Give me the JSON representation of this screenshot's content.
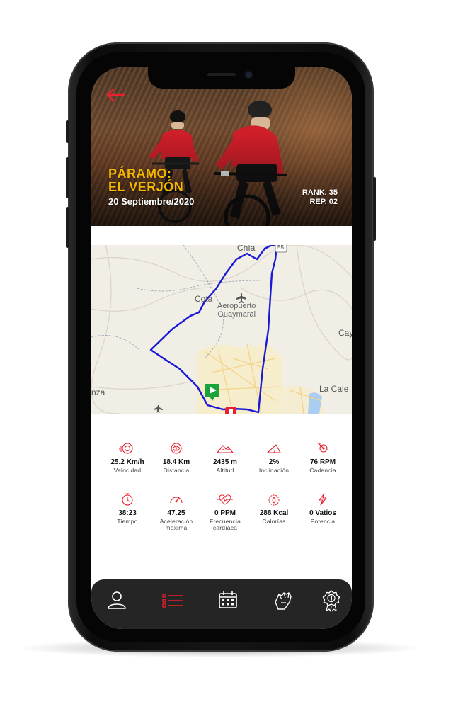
{
  "event": {
    "title": "PÁRAMO:\nEL VERJÓN",
    "date": "20 Septiembre/2020",
    "rank": "RANK. 35",
    "rep": "REP. 02"
  },
  "map": {
    "labels": {
      "chia": "Chía",
      "route_55": "55",
      "cota": "Cota",
      "airport": "Aeropuerto\nGuaymaral",
      "cay": "Cay",
      "la_cale": "La Cale",
      "nza": "nza"
    }
  },
  "stats": [
    {
      "value": "25.2 Km/h",
      "label": "Velocidad",
      "icon": "speedometer-icon"
    },
    {
      "value": "18.4 Km",
      "label": "Distancia",
      "icon": "distance-icon"
    },
    {
      "value": "2435 m",
      "label": "Altitud",
      "icon": "mountain-icon"
    },
    {
      "value": "2%",
      "label": "Inclinación",
      "icon": "incline-icon"
    },
    {
      "value": "76 RPM",
      "label": "Cadencia",
      "icon": "cadence-icon"
    },
    {
      "value": "38:23",
      "label": "Tiempo",
      "icon": "stopwatch-icon"
    },
    {
      "value": "47.25",
      "label": "Aceleración\nmáxima",
      "icon": "gauge-icon"
    },
    {
      "value": "0 PPM",
      "label": "Frecuencia\ncardíaca",
      "icon": "heart-rate-icon"
    },
    {
      "value": "288 Kcal",
      "label": "Calorías",
      "icon": "calories-icon"
    },
    {
      "value": "0 Vatios",
      "label": "Potencia",
      "icon": "lightning-icon"
    }
  ],
  "colors": {
    "accent": "#e8202f",
    "title_yellow": "#f5b800",
    "route": "#1a1ad6",
    "nav_bg": "#252525"
  },
  "nav": [
    {
      "name": "profile",
      "icon": "user-icon",
      "active": false
    },
    {
      "name": "activities",
      "icon": "list-icon",
      "active": true
    },
    {
      "name": "calendar",
      "icon": "calendar-icon",
      "active": false
    },
    {
      "name": "training",
      "icon": "glove-icon",
      "active": false
    },
    {
      "name": "awards",
      "icon": "medal-icon",
      "active": false
    }
  ]
}
